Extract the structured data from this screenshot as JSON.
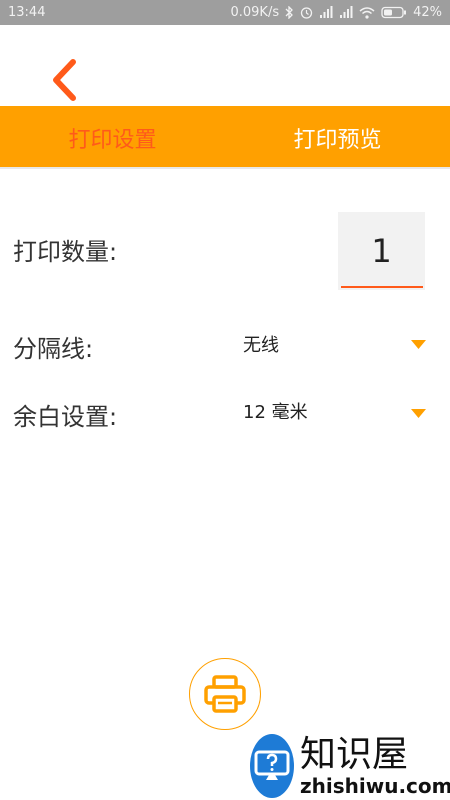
{
  "status_bar": {
    "time": "13:44",
    "network_speed": "0.09K/s",
    "battery_percent": "42%",
    "icons": [
      "bluetooth-icon",
      "alarm-icon",
      "signal-icon",
      "signal-icon",
      "wifi-icon",
      "battery-icon"
    ]
  },
  "tabs": [
    {
      "label": "打印设置",
      "active": true
    },
    {
      "label": "打印预览",
      "active": false
    }
  ],
  "settings": {
    "quantity_label": "打印数量:",
    "quantity_value": "1",
    "separator_label": "分隔线:",
    "separator_value": "无线",
    "margin_label": "余白设置:",
    "margin_value": "12 毫米"
  },
  "watermark": {
    "chinese": "知识屋",
    "english": "zhishiwu.com",
    "registered_mark": "®"
  },
  "colors": {
    "accent": "#ffa000",
    "active_tab": "#ff5a1a",
    "status_bar": "#9e9e9e",
    "watermark_blue": "#1e7bd6"
  }
}
